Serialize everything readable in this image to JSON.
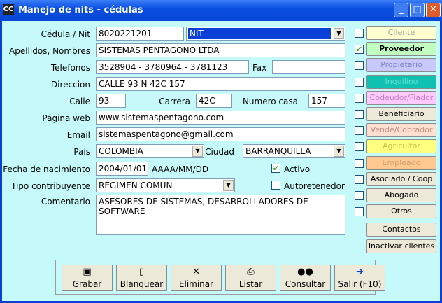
{
  "window": {
    "title": "Manejo de nits - cédulas",
    "app_icon": "CC"
  },
  "form": {
    "cedula_label": "Cédula / Nit",
    "cedula_value": "8020221201",
    "nit_type": "NIT",
    "apellidos_label": "Apellidos, Nombres",
    "apellidos_value": "SISTEMAS PENTAGONO LTDA",
    "telefonos_label": "Telefonos",
    "telefonos_value": "3528904 - 3780964 - 3781123",
    "fax_label": "Fax",
    "fax_value": "",
    "direccion_label": "Direccion",
    "direccion_value": "CALLE 93 N 42C 157",
    "calle_label": "Calle",
    "calle_value": "93",
    "carrera_label": "Carrera",
    "carrera_value": "42C",
    "numero_label": "Numero casa",
    "numero_value": "157",
    "pagina_label": "Página web",
    "pagina_value": "www.sistemaspentagono.com",
    "email_label": "Email",
    "email_value": "sistemaspentagono@gmail.com",
    "pais_label": "País",
    "pais_value": "COLOMBIA",
    "ciudad_label": "Ciudad",
    "ciudad_value": "BARRANQUILLA",
    "fecha_label": "Fecha de nacimiento",
    "fecha_value": "2004/01/01",
    "fecha_format": "AAAA/MM/DD",
    "activo_label": "Activo",
    "tipo_label": "Tipo contribuyente",
    "tipo_value": "REGIMEN COMUN",
    "autoretenedor_label": "Autoretenedor",
    "comentario_label": "Comentario",
    "comentario_value": "ASESORES DE SISTEMAS, DESARROLLADORES DE SOFTWARE"
  },
  "roles": [
    {
      "label": "Cliente",
      "checked": false,
      "color": "#ffffd0",
      "text_color": "#a0a0a0"
    },
    {
      "label": "Proveedor",
      "checked": true,
      "color": "#c0ffc0",
      "text_color": "#000000"
    },
    {
      "label": "Propietario",
      "checked": false,
      "color": "#c8c8ff",
      "text_color": "#8080c0"
    },
    {
      "label": "Inquilino",
      "checked": false,
      "color": "#10c0b0",
      "text_color": "#60e0d8"
    },
    {
      "label": "Codeudor/Fiador",
      "checked": false,
      "color": "#ffc8ff",
      "text_color": "#c080c0"
    },
    {
      "label": "Beneficiario",
      "checked": false,
      "color": "#ece9d8",
      "text_color": "#000000"
    },
    {
      "label": "Vende/Cobrador",
      "checked": false,
      "color": "#ffe0d0",
      "text_color": "#c09080"
    },
    {
      "label": "Agricultor",
      "checked": false,
      "color": "#ffff80",
      "text_color": "#c0c040"
    },
    {
      "label": "Empleado",
      "checked": false,
      "color": "#ffc890",
      "text_color": "#d0a070"
    },
    {
      "label": "Asociado / Coop",
      "checked": false,
      "color": "#ece9d8",
      "text_color": "#000000"
    },
    {
      "label": "Abogado",
      "checked": false,
      "color": "#ece9d8",
      "text_color": "#000000"
    },
    {
      "label": "Otros",
      "checked": false,
      "color": "#ece9d8",
      "text_color": "#000000"
    }
  ],
  "actions": {
    "contactos": "Contactos",
    "inactivar": "Inactivar clientes"
  },
  "toolbar": {
    "grabar": "Grabar",
    "blanquear": "Blanquear",
    "eliminar": "Eliminar",
    "listar": "Listar",
    "consultar": "Consultar",
    "salir": "Salir (F10)"
  }
}
